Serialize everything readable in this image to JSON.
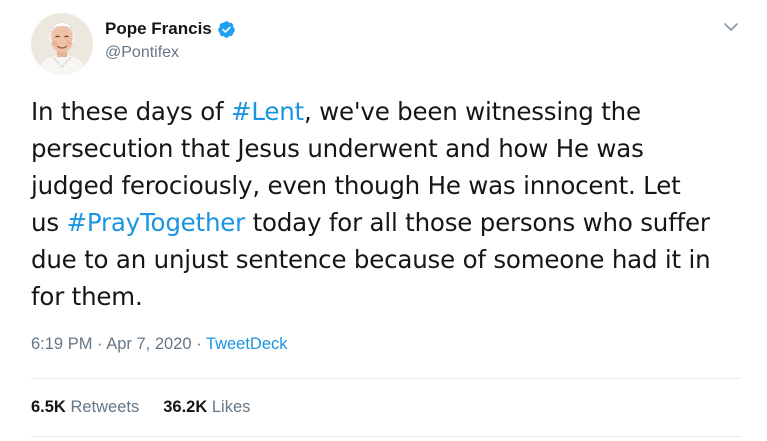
{
  "author": {
    "display_name": "Pope Francis",
    "handle": "@Pontifex",
    "verified": true,
    "avatar_icon": "avatar-portrait"
  },
  "tweet": {
    "lines": [
      [
        "In these days of ",
        "#Lent",
        ", we've been witnessing the"
      ],
      [
        "persecution that Jesus underwent and how He was"
      ],
      [
        "judged ferociously, even though He was innocent. Let"
      ],
      [
        "us ",
        "#PrayTogether",
        " today for all those persons who suffer"
      ],
      [
        "due to an unjust sentence because of someone had it in"
      ],
      [
        "for them."
      ]
    ],
    "hashtags": [
      "#Lent",
      "#PrayTogether"
    ]
  },
  "meta": {
    "time": "6:19 PM",
    "separator1": " · ",
    "date": "Apr 7, 2020",
    "separator2": " · ",
    "source": "TweetDeck"
  },
  "stats": {
    "retweets_count": "6.5K",
    "retweets_label": "Retweets",
    "likes_count": "36.2K",
    "likes_label": "Likes"
  },
  "colors": {
    "link": "#1b95e0",
    "verified": "#1da1f2",
    "muted": "#657786",
    "text": "#14171a",
    "divider": "#e6ecf0"
  },
  "icons": {
    "verified": "verified-badge-icon",
    "caret": "chevron-down-icon"
  }
}
